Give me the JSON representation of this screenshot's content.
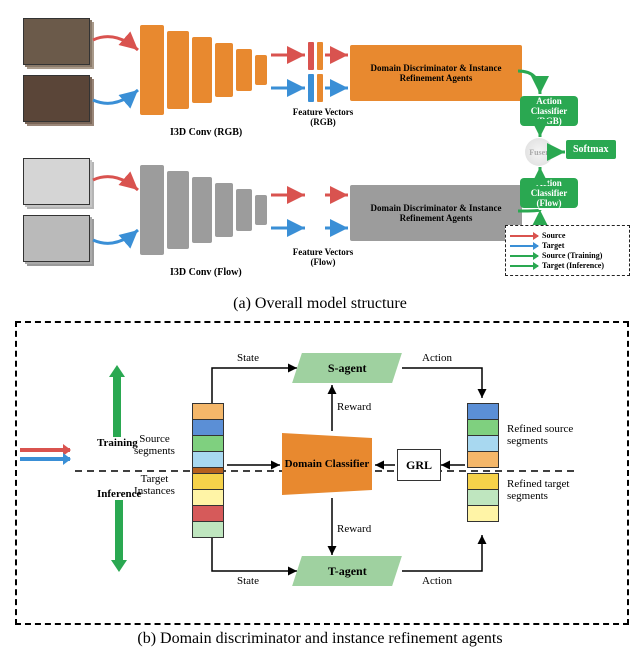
{
  "captions": {
    "a": "(a) Overall model structure",
    "b": "(b) Domain discriminator and instance refinement agents"
  },
  "panel_a": {
    "backbone_rgb": "I3D Conv (RGB)",
    "backbone_flow": "I3D Conv (Flow)",
    "fv_rgb": "Feature Vectors (RGB)",
    "fv_flow": "Feature Vectors (Flow)",
    "box_rgb": "Domain Discriminator & Instance Refinement Agents",
    "box_flow": "Domain Discriminator & Instance Refinement Agents",
    "cls_rgb": "Action Classifier (RGB)",
    "cls_flow": "Action Classifier (Flow)",
    "fuser": "Fuser",
    "softmax": "Softmax"
  },
  "legend": {
    "source": "Source",
    "target": "Target",
    "src_train": "Source (Training)",
    "tgt_inf": "Target (Inference)"
  },
  "panel_b": {
    "training": "Training",
    "inference": "Inference",
    "src_seg": "Source segments",
    "tgt_inst": "Target Instances",
    "s_agent": "S-agent",
    "t_agent": "T-agent",
    "domain": "Domain Classifier",
    "grl": "GRL",
    "refined_src": "Refined source segments",
    "refined_tgt": "Refined target segments",
    "state": "State",
    "action": "Action",
    "reward": "Reward"
  }
}
